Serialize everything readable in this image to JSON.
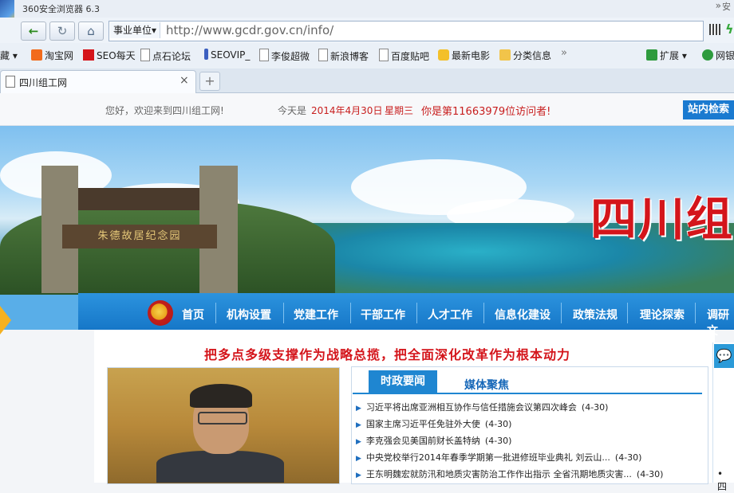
{
  "browser": {
    "title": "360安全浏览器 6.3",
    "title_extra": "安",
    "title_more": "»",
    "address_category": "事业单位▾",
    "url": "http://www.gcdr.gov.cn/info/",
    "bookmarks": [
      {
        "label": "藏 ▾"
      },
      {
        "label": "淘宝网"
      },
      {
        "label": "SEO每天"
      },
      {
        "label": "点石论坛"
      },
      {
        "label": "SEOVIP_"
      },
      {
        "label": "李俊超微"
      },
      {
        "label": "新浪博客"
      },
      {
        "label": "百度贴吧"
      },
      {
        "label": "最新电影"
      },
      {
        "label": "分类信息"
      }
    ],
    "bookmarks_more": "»",
    "extension_label": "扩展 ▾",
    "net_label": "网银",
    "tab_title": "四川组工网",
    "tab_close": "×",
    "new_tab": "+"
  },
  "page": {
    "welcome": "您好，欢迎来到四川组工网!",
    "today_label": "今天是",
    "date": "2014年4月30日",
    "weekday": "星期三",
    "visitor": "你是第11663979位访问者!",
    "site_search": "站内检索",
    "banner_title": "四川组",
    "gate_sign": "朱德故居纪念园",
    "menu": [
      "首页",
      "机构设置",
      "党建工作",
      "干部工作",
      "人才工作",
      "信息化建设",
      "政策法规",
      "理论探索",
      "调研文"
    ],
    "headline": "把多点多级支撑作为战略总揽，把全面深化改革作为根本动力",
    "news_tabs": {
      "active": "时政要闻",
      "other": "媒体聚焦"
    },
    "news": [
      {
        "title": "习近平将出席亚洲相互协作与信任措施会议第四次峰会",
        "date": "(4-30)"
      },
      {
        "title": "国家主席习近平任免驻外大使",
        "date": "(4-30)"
      },
      {
        "title": "李克强会见美国前财长盖特纳",
        "date": "(4-30)"
      },
      {
        "title": "中央党校举行2014年春季学期第一批进修班毕业典礼 刘云山...",
        "date": "(4-30)"
      },
      {
        "title": "王东明魏宏就防汛和地质灾害防治工作作出指示  全省汛期地质灾害...",
        "date": "(4-30)"
      }
    ],
    "right_panel_dot": "• 四"
  }
}
